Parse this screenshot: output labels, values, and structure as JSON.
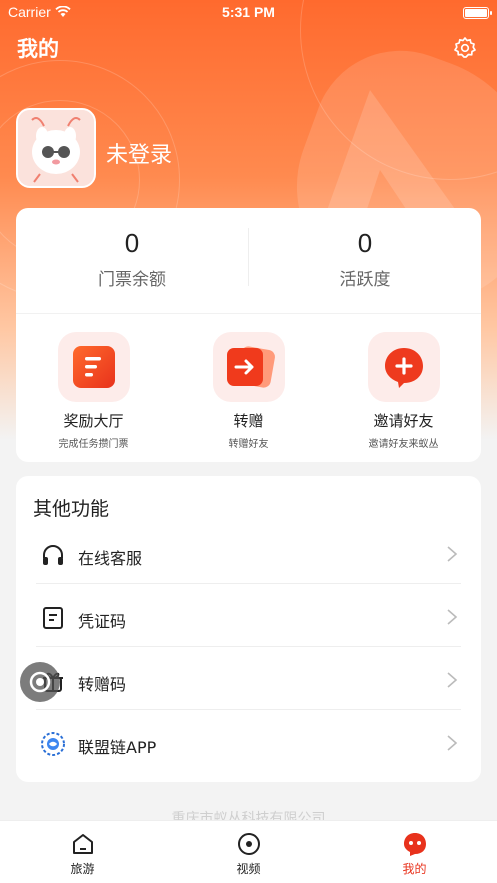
{
  "status_bar": {
    "carrier": "Carrier",
    "time": "5:31 PM"
  },
  "header": {
    "title": "我的"
  },
  "profile": {
    "login_text": "未登录"
  },
  "stats": [
    {
      "value": "0",
      "label": "门票余额"
    },
    {
      "value": "0",
      "label": "活跃度"
    }
  ],
  "features": [
    {
      "name": "奖励大厅",
      "sub": "完成任务攒门票",
      "icon": "reward-hall-icon"
    },
    {
      "name": "转赠",
      "sub": "转赠好友",
      "icon": "transfer-icon"
    },
    {
      "name": "邀请好友",
      "sub": "邀请好友来蚁丛",
      "icon": "invite-icon"
    }
  ],
  "other": {
    "title": "其他功能",
    "items": [
      {
        "label": "在线客服",
        "icon": "headphones-icon"
      },
      {
        "label": "凭证码",
        "icon": "document-icon"
      },
      {
        "label": "转赠码",
        "icon": "gift-icon"
      },
      {
        "label": "联盟链APP",
        "icon": "alliance-chain-logo-icon"
      }
    ]
  },
  "footer": {
    "company": "重庆市蚁丛科技有限公司"
  },
  "tabs": [
    {
      "label": "旅游",
      "icon": "home-icon"
    },
    {
      "label": "视频",
      "icon": "video-circle-icon"
    },
    {
      "label": "我的",
      "icon": "profile-face-icon",
      "active": true
    }
  ],
  "colors": {
    "brand": "#ff5a1f",
    "active_tab": "#e8321c",
    "background": "#f3f3f3"
  }
}
